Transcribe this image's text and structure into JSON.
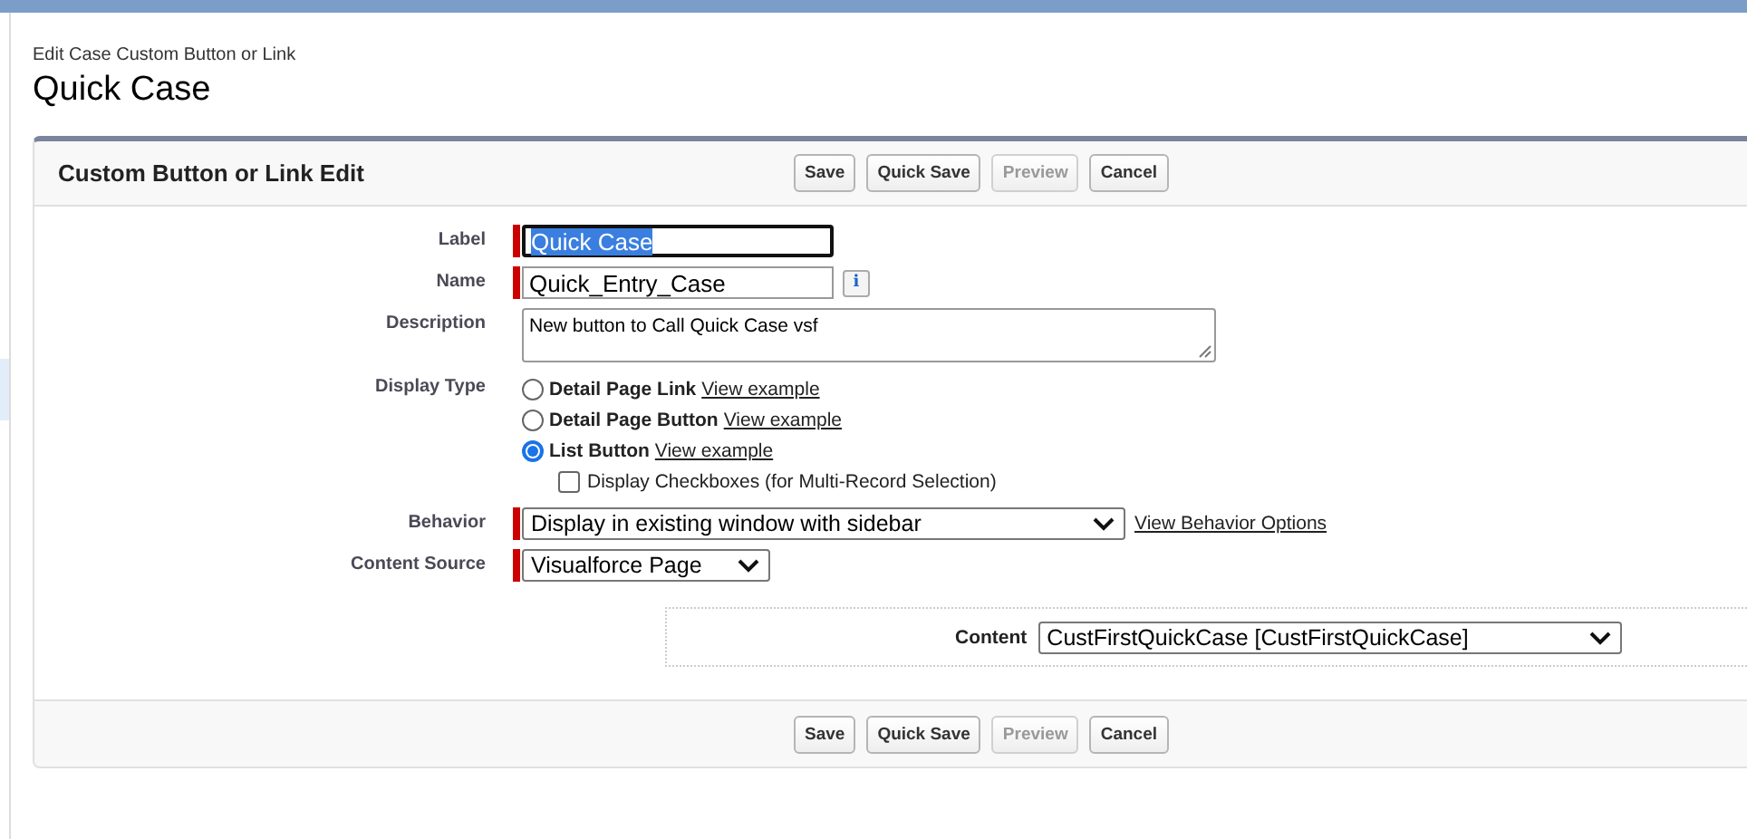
{
  "page_header": {
    "breadcrumb": "Edit Case Custom Button or Link",
    "title": "Quick Case"
  },
  "panel": {
    "title": "Custom Button or Link Edit",
    "top_buttons": [
      {
        "label": "Save",
        "disabled": false
      },
      {
        "label": "Quick Save",
        "disabled": false
      },
      {
        "label": "Preview",
        "disabled": true
      },
      {
        "label": "Cancel",
        "disabled": false
      }
    ],
    "fields": [
      {
        "kind": "text",
        "label": "Label",
        "value": "Quick Case",
        "required": true,
        "focused": true
      },
      {
        "kind": "text",
        "label": "Name",
        "value": "Quick_Entry_Case",
        "required": true,
        "focused": false,
        "info": "i"
      },
      {
        "kind": "textarea",
        "label": "Description",
        "value": "New button to Call Quick Case vsf",
        "required": false
      },
      {
        "kind": "radio",
        "label": "Display Type",
        "required": false,
        "options": [
          {
            "label": "Detail Page Link",
            "link": "View example",
            "selected": false
          },
          {
            "label": "Detail Page Button",
            "link": "View example",
            "selected": false
          },
          {
            "label": "List Button",
            "link": "View example",
            "selected": true
          }
        ],
        "checkbox": {
          "label": "Display Checkboxes (for Multi-Record Selection)",
          "checked": false
        }
      },
      {
        "kind": "select",
        "label": "Behavior",
        "value": "Display in existing window with sidebar",
        "required": true,
        "link": "View Behavior Options",
        "wide": true
      },
      {
        "kind": "select",
        "label": "Content Source",
        "value": "Visualforce Page",
        "required": true,
        "wide": false
      }
    ],
    "content": {
      "label": "Content",
      "value": "CustFirstQuickCase [CustFirstQuickCase]"
    },
    "bottom_buttons": [
      {
        "label": "Save",
        "disabled": false
      },
      {
        "label": "Quick Save",
        "disabled": false
      },
      {
        "label": "Preview",
        "disabled": true
      },
      {
        "label": "Cancel",
        "disabled": false
      }
    ]
  }
}
